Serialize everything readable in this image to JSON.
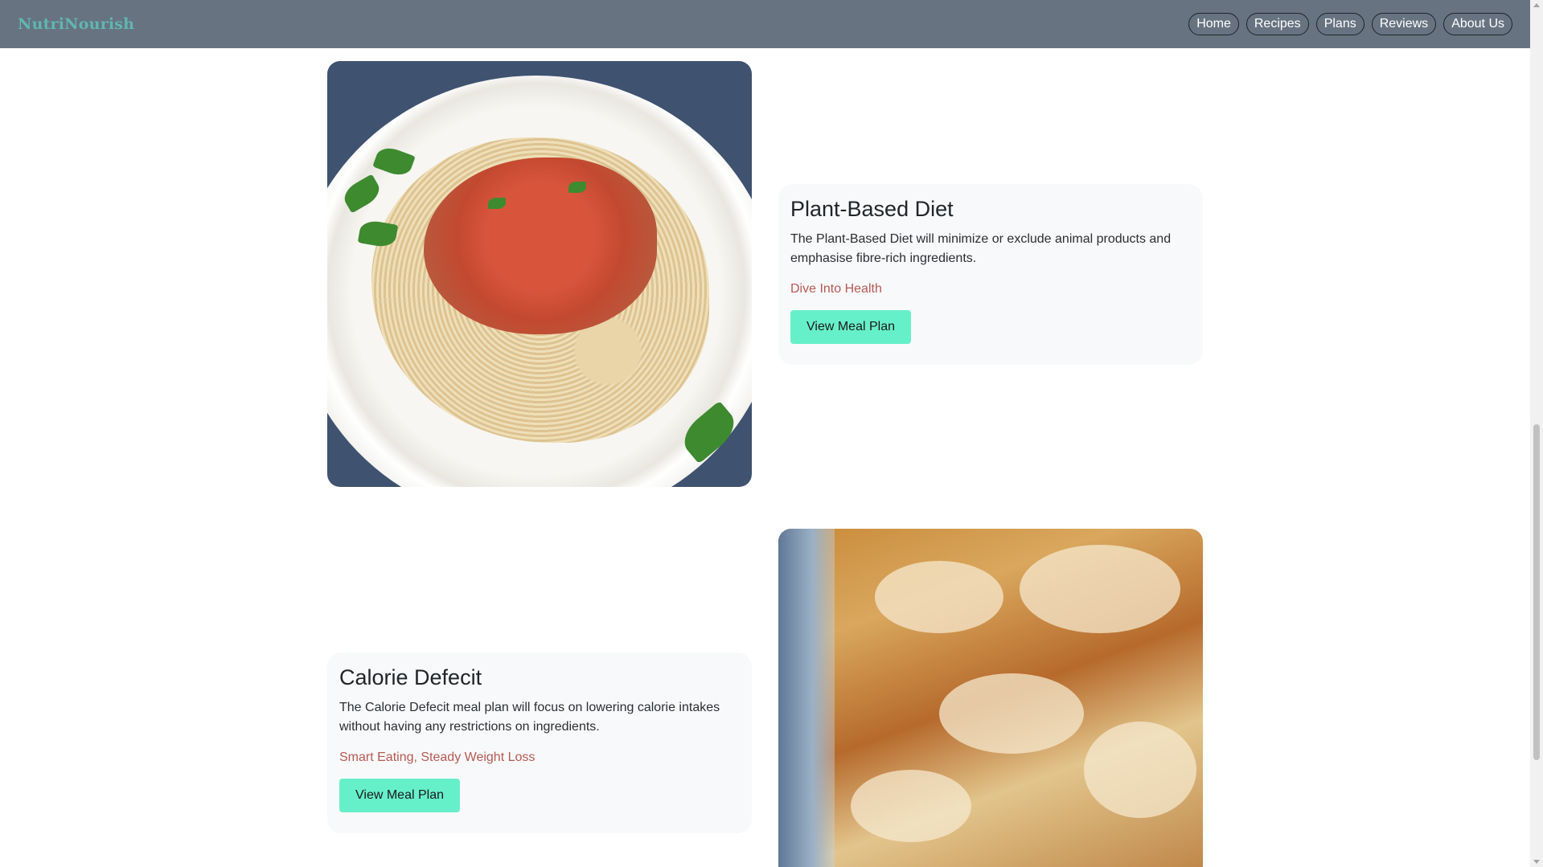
{
  "navbar": {
    "brand": "NutriNourish",
    "links": [
      "Home",
      "Recipes",
      "Plans",
      "Reviews",
      "About Us"
    ]
  },
  "plans": [
    {
      "title": "Plant-Based Diet",
      "description": "The Plant-Based Diet will minimize or exclude animal products and emphasise fibre-rich ingredients.",
      "tagline": "Dive Into Health",
      "button_label": "View Meal Plan",
      "image": "chicken-rice-plate"
    },
    {
      "title": "Calorie Defecit",
      "description": "The Calorie Defecit meal plan will focus on lowering calorie intakes without having any restrictions on ingredients.",
      "tagline": "Smart Eating, Steady Weight Loss",
      "button_label": "View Meal Plan",
      "image": "baked-lasagna"
    }
  ],
  "colors": {
    "navbar_bg": "#677380",
    "brand": "#5fb7b0",
    "tagline": "#b55a52",
    "button_bg": "#66f0c9",
    "card_bg": "#f8f9fa"
  }
}
